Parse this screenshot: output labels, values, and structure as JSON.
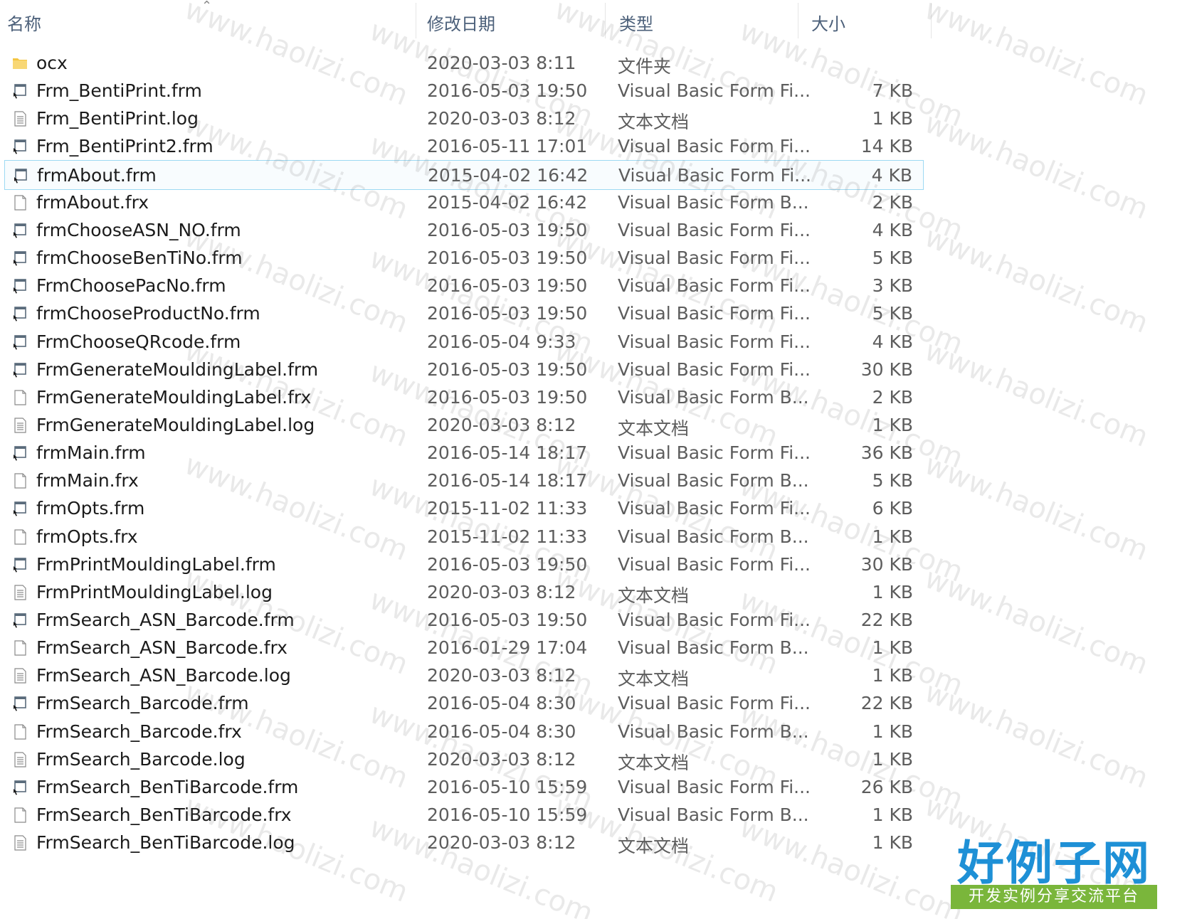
{
  "columns": {
    "name": "名称",
    "date": "修改日期",
    "type": "类型",
    "size": "大小"
  },
  "sort": {
    "column": "name",
    "direction": "ascending",
    "icon": "chevron-up-icon"
  },
  "selected_row_index": 4,
  "files": [
    {
      "name": "ocx",
      "date": "2020-03-03 8:11",
      "type": "文件夹",
      "size": "",
      "icon": "folder-icon"
    },
    {
      "name": "Frm_BentiPrint.frm",
      "date": "2016-05-03 19:50",
      "type": "Visual Basic Form Fi...",
      "size": "7 KB",
      "icon": "vb-form-icon"
    },
    {
      "name": "Frm_BentiPrint.log",
      "date": "2020-03-03 8:12",
      "type": "文本文档",
      "size": "1 KB",
      "icon": "text-file-icon"
    },
    {
      "name": "Frm_BentiPrint2.frm",
      "date": "2016-05-11 17:01",
      "type": "Visual Basic Form Fi...",
      "size": "14 KB",
      "icon": "vb-form-icon"
    },
    {
      "name": "frmAbout.frm",
      "date": "2015-04-02 16:42",
      "type": "Visual Basic Form Fi...",
      "size": "4 KB",
      "icon": "vb-form-icon"
    },
    {
      "name": "frmAbout.frx",
      "date": "2015-04-02 16:42",
      "type": "Visual Basic Form B...",
      "size": "2 KB",
      "icon": "blank-file-icon"
    },
    {
      "name": "frmChooseASN_NO.frm",
      "date": "2016-05-03 19:50",
      "type": "Visual Basic Form Fi...",
      "size": "4 KB",
      "icon": "vb-form-icon"
    },
    {
      "name": "frmChooseBenTiNo.frm",
      "date": "2016-05-03 19:50",
      "type": "Visual Basic Form Fi...",
      "size": "5 KB",
      "icon": "vb-form-icon"
    },
    {
      "name": "FrmChoosePacNo.frm",
      "date": "2016-05-03 19:50",
      "type": "Visual Basic Form Fi...",
      "size": "3 KB",
      "icon": "vb-form-icon"
    },
    {
      "name": "frmChooseProductNo.frm",
      "date": "2016-05-03 19:50",
      "type": "Visual Basic Form Fi...",
      "size": "5 KB",
      "icon": "vb-form-icon"
    },
    {
      "name": "FrmChooseQRcode.frm",
      "date": "2016-05-04 9:33",
      "type": "Visual Basic Form Fi...",
      "size": "4 KB",
      "icon": "vb-form-icon"
    },
    {
      "name": "FrmGenerateMouldingLabel.frm",
      "date": "2016-05-03 19:50",
      "type": "Visual Basic Form Fi...",
      "size": "30 KB",
      "icon": "vb-form-icon"
    },
    {
      "name": "FrmGenerateMouldingLabel.frx",
      "date": "2016-05-03 19:50",
      "type": "Visual Basic Form B...",
      "size": "2 KB",
      "icon": "blank-file-icon"
    },
    {
      "name": "FrmGenerateMouldingLabel.log",
      "date": "2020-03-03 8:12",
      "type": "文本文档",
      "size": "1 KB",
      "icon": "text-file-icon"
    },
    {
      "name": "frmMain.frm",
      "date": "2016-05-14 18:17",
      "type": "Visual Basic Form Fi...",
      "size": "36 KB",
      "icon": "vb-form-icon"
    },
    {
      "name": "frmMain.frx",
      "date": "2016-05-14 18:17",
      "type": "Visual Basic Form B...",
      "size": "5 KB",
      "icon": "blank-file-icon"
    },
    {
      "name": "frmOpts.frm",
      "date": "2015-11-02 11:33",
      "type": "Visual Basic Form Fi...",
      "size": "6 KB",
      "icon": "vb-form-icon"
    },
    {
      "name": "frmOpts.frx",
      "date": "2015-11-02 11:33",
      "type": "Visual Basic Form B...",
      "size": "1 KB",
      "icon": "blank-file-icon"
    },
    {
      "name": "FrmPrintMouldingLabel.frm",
      "date": "2016-05-03 19:50",
      "type": "Visual Basic Form Fi...",
      "size": "30 KB",
      "icon": "vb-form-icon"
    },
    {
      "name": "FrmPrintMouldingLabel.log",
      "date": "2020-03-03 8:12",
      "type": "文本文档",
      "size": "1 KB",
      "icon": "text-file-icon"
    },
    {
      "name": "FrmSearch_ASN_Barcode.frm",
      "date": "2016-05-03 19:50",
      "type": "Visual Basic Form Fi...",
      "size": "22 KB",
      "icon": "vb-form-icon"
    },
    {
      "name": "FrmSearch_ASN_Barcode.frx",
      "date": "2016-01-29 17:04",
      "type": "Visual Basic Form B...",
      "size": "1 KB",
      "icon": "blank-file-icon"
    },
    {
      "name": "FrmSearch_ASN_Barcode.log",
      "date": "2020-03-03 8:12",
      "type": "文本文档",
      "size": "1 KB",
      "icon": "text-file-icon"
    },
    {
      "name": "FrmSearch_Barcode.frm",
      "date": "2016-05-04 8:30",
      "type": "Visual Basic Form Fi...",
      "size": "22 KB",
      "icon": "vb-form-icon"
    },
    {
      "name": "FrmSearch_Barcode.frx",
      "date": "2016-05-04 8:30",
      "type": "Visual Basic Form B...",
      "size": "1 KB",
      "icon": "blank-file-icon"
    },
    {
      "name": "FrmSearch_Barcode.log",
      "date": "2020-03-03 8:12",
      "type": "文本文档",
      "size": "1 KB",
      "icon": "text-file-icon"
    },
    {
      "name": "FrmSearch_BenTiBarcode.frm",
      "date": "2016-05-10 15:59",
      "type": "Visual Basic Form Fi...",
      "size": "26 KB",
      "icon": "vb-form-icon"
    },
    {
      "name": "FrmSearch_BenTiBarcode.frx",
      "date": "2016-05-10 15:59",
      "type": "Visual Basic Form B...",
      "size": "1 KB",
      "icon": "blank-file-icon"
    },
    {
      "name": "FrmSearch_BenTiBarcode.log",
      "date": "2020-03-03 8:12",
      "type": "文本文档",
      "size": "1 KB",
      "icon": "text-file-icon"
    }
  ],
  "watermark": {
    "text": "www.haolizi.com"
  },
  "logo": {
    "title": "好例子网",
    "subtitle": "开发实例分享交流平台"
  },
  "colors": {
    "header_text": "#4c607a",
    "selected_border": "#9dd9f3",
    "folder": "#f4c542",
    "logo_blue": "#1e90d6",
    "logo_green": "#7ab63b"
  }
}
